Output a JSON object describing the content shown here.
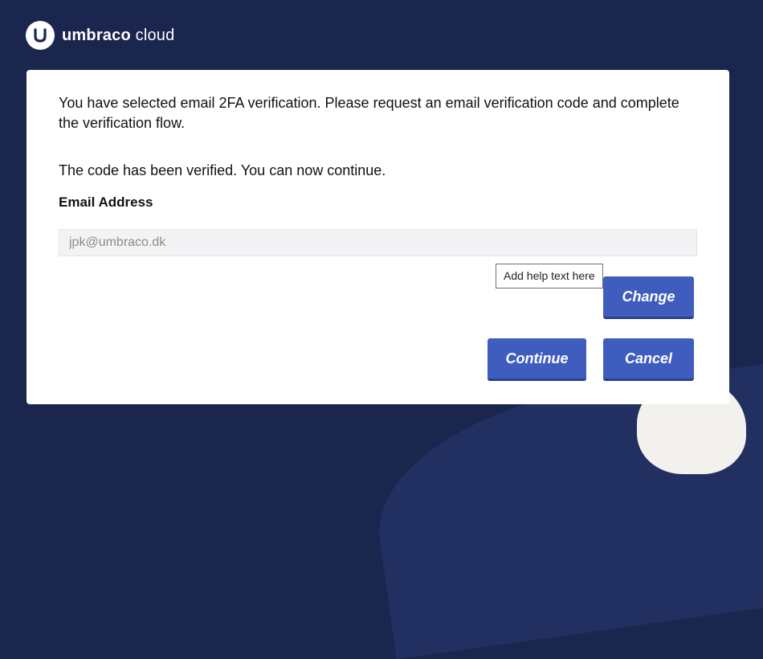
{
  "brand": {
    "name_part1": "umbraco",
    "name_part2": "cloud",
    "logo_icon": "umbraco-u-logo"
  },
  "card": {
    "intro_text": "You have selected email 2FA verification. Please request an email verification code and complete the verification flow.",
    "verified_text": "The code has been verified. You can now continue.",
    "email_label": "Email Address",
    "email_value": "jpk@umbraco.dk",
    "help_tooltip": "Add help text here",
    "change_label": "Change",
    "continue_label": "Continue",
    "cancel_label": "Cancel"
  },
  "colors": {
    "background": "#1b264f",
    "card": "#ffffff",
    "button": "#3f5dbe",
    "button_shadow": "#2b3f8a",
    "input_bg": "#f3f3f5"
  }
}
